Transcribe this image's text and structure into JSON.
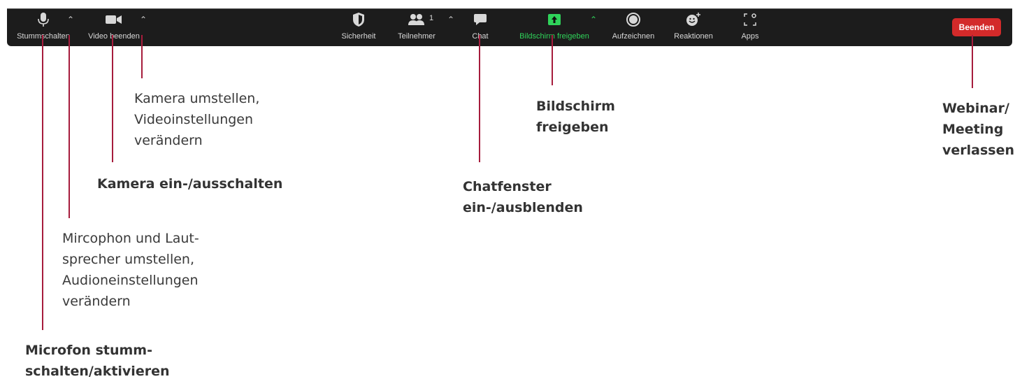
{
  "toolbar": {
    "mute_label": "Stummschalten",
    "video_label": "Video beenden",
    "security_label": "Sicherheit",
    "participants_label": "Teilnehmer",
    "participants_count": "1",
    "chat_label": "Chat",
    "share_label": "Bildschirm freigeben",
    "record_label": "Aufzeichnen",
    "reactions_label": "Reaktionen",
    "apps_label": "Apps",
    "end_label": "Beenden"
  },
  "colors": {
    "toolbar_bg": "#1c1c1c",
    "share_green": "#2fd35a",
    "end_red": "#d32a2a",
    "annotation_line": "#a61c3c"
  },
  "annotations": {
    "camera_settings": [
      "Kamera umstellen,",
      "Videoinstellungen",
      "verändern"
    ],
    "camera_toggle": [
      "Kamera ein-/ausschalten"
    ],
    "mic_settings": [
      "Mircophon und Laut-",
      "sprecher umstellen,",
      "Audioneinstellungen",
      "verändern"
    ],
    "mic_mute": [
      "Microfon stumm-",
      "schalten/aktivieren"
    ],
    "chat": [
      "Chatfenster",
      "ein-/ausblenden"
    ],
    "share": [
      "Bildschirm",
      "freigeben"
    ],
    "leave": [
      "Webinar/",
      "Meeting",
      "verlassen"
    ]
  }
}
